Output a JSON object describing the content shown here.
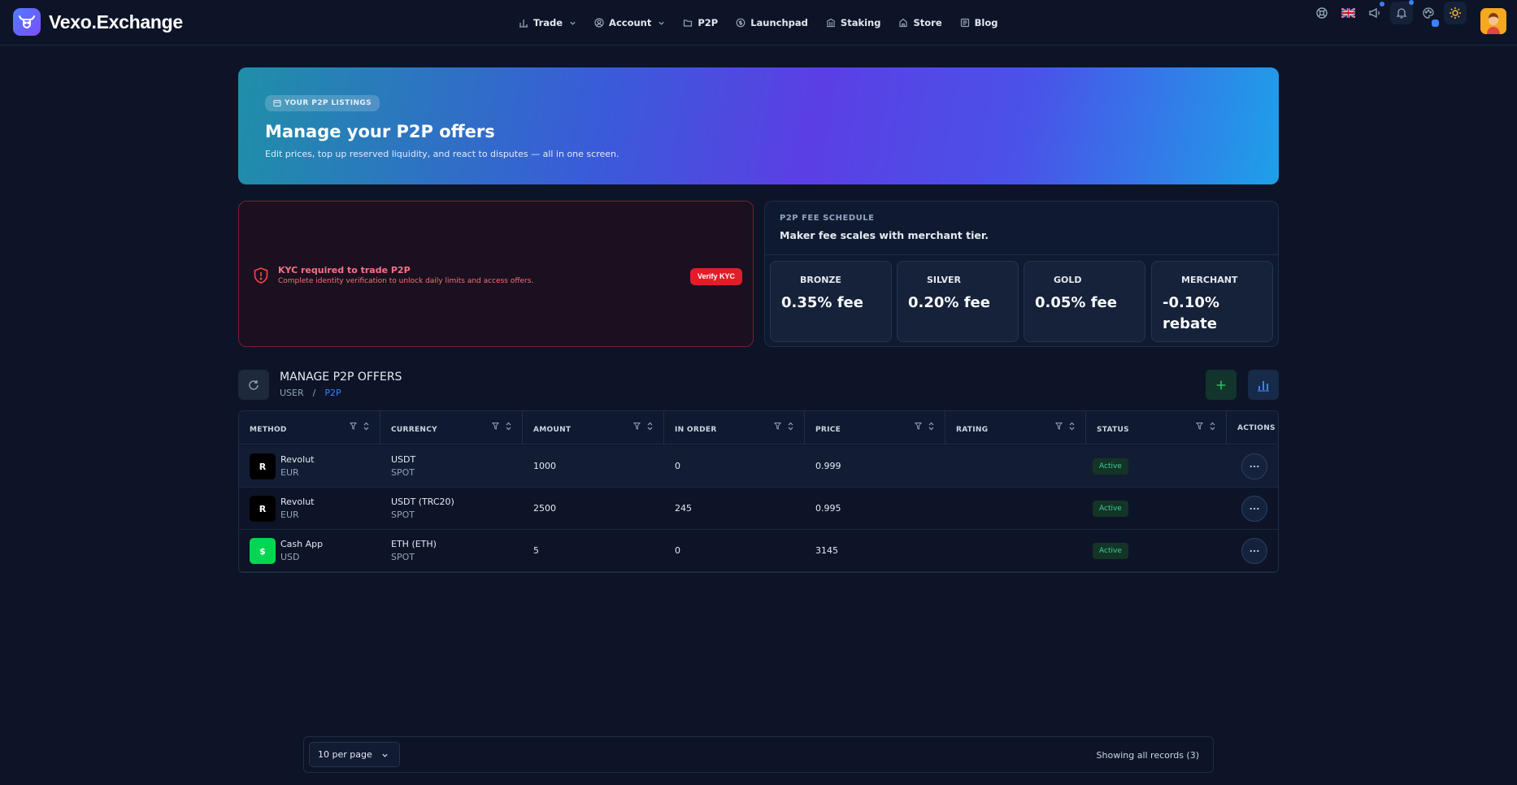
{
  "brand": {
    "name": "Vexo.Exchange"
  },
  "nav": [
    {
      "label": "Trade",
      "icon": "bar-chart-icon",
      "dropdown": true
    },
    {
      "label": "Account",
      "icon": "user-icon",
      "dropdown": true
    },
    {
      "label": "P2P",
      "icon": "folder-icon",
      "dropdown": false
    },
    {
      "label": "Launchpad",
      "icon": "coin-icon",
      "dropdown": false
    },
    {
      "label": "Staking",
      "icon": "bank-icon",
      "dropdown": false
    },
    {
      "label": "Store",
      "icon": "store-icon",
      "dropdown": false
    },
    {
      "label": "Blog",
      "icon": "newspaper-icon",
      "dropdown": false
    }
  ],
  "hero": {
    "pill": "YOUR P2P LISTINGS",
    "title": "Manage your P2P offers",
    "subtitle": "Edit prices, top up reserved liquidity, and react to disputes — all in one screen."
  },
  "kyc": {
    "title": "KYC required to trade P2P",
    "subtitle": "Complete identity verification to unlock daily limits and access offers.",
    "button": "Verify KYC"
  },
  "fees": {
    "label": "P2P FEE SCHEDULE",
    "title": "Maker fee scales with merchant tier.",
    "tiers": [
      {
        "name": "BRONZE",
        "value": "0.35% fee"
      },
      {
        "name": "SILVER",
        "value": "0.20% fee"
      },
      {
        "name": "GOLD",
        "value": "0.05% fee"
      },
      {
        "name": "MERCHANT",
        "value": "-0.10% rebate"
      }
    ]
  },
  "manage": {
    "title": "MANAGE P2P OFFERS",
    "breadcrumb": [
      "USER",
      "/",
      "P2P"
    ]
  },
  "table": {
    "columns": [
      "METHOD",
      "CURRENCY",
      "AMOUNT",
      "IN ORDER",
      "PRICE",
      "RATING",
      "STATUS",
      "ACTIONS"
    ],
    "rows": [
      {
        "method": "Revolut",
        "method_letter": "R",
        "method_color": "#000000",
        "fiat": "EUR",
        "currency": "USDT",
        "market": "SPOT",
        "amount": "1000",
        "in_order": "0",
        "price": "0.999",
        "rating": "",
        "status": "Active"
      },
      {
        "method": "Revolut",
        "method_letter": "R",
        "method_color": "#000000",
        "fiat": "EUR",
        "currency": "USDT (TRC20)",
        "market": "SPOT",
        "amount": "2500",
        "in_order": "245",
        "price": "0.995",
        "rating": "",
        "status": "Active"
      },
      {
        "method": "Cash App",
        "method_letter": "$",
        "method_color": "#00d64f",
        "fiat": "USD",
        "currency": "ETH (ETH)",
        "market": "SPOT",
        "amount": "5",
        "in_order": "0",
        "price": "3145",
        "rating": "",
        "status": "Active"
      }
    ]
  },
  "pager": {
    "per_page": "10 per page",
    "records": "Showing all records (3)"
  }
}
